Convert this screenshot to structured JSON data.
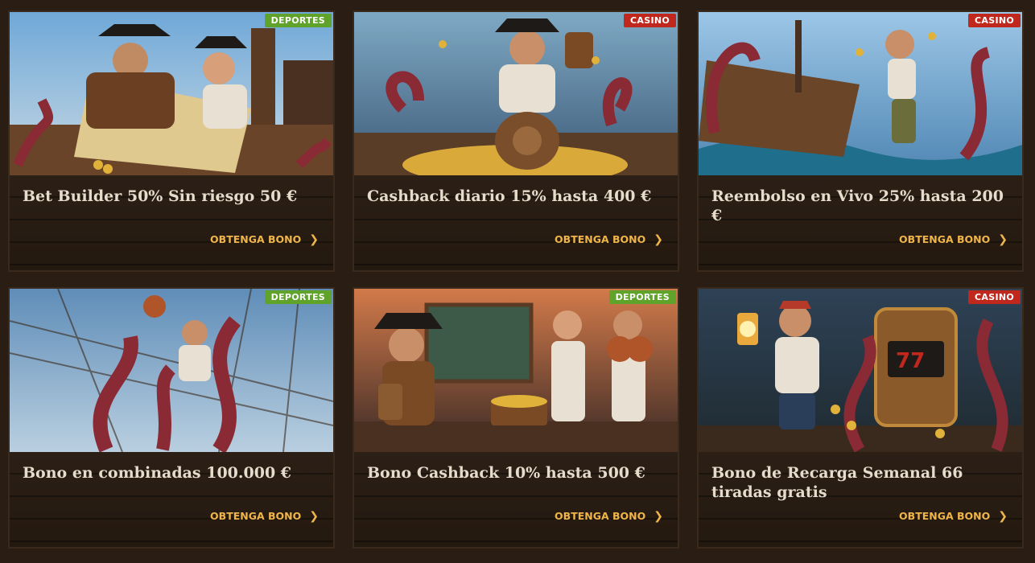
{
  "cards": [
    {
      "badge": "DEPORTES",
      "title": "Bet Builder 50% Sin riesgo 50 €",
      "cta": "OBTENGA BONO"
    },
    {
      "badge": "CASINO",
      "title": "Cashback diario 15% hasta 400 €",
      "cta": "OBTENGA BONO"
    },
    {
      "badge": "CASINO",
      "title": "Reembolso en Vivo 25% hasta 200 €",
      "cta": "OBTENGA BONO"
    },
    {
      "badge": "DEPORTES",
      "title": "Bono en combinadas 100.000 €",
      "cta": "OBTENGA BONO"
    },
    {
      "badge": "DEPORTES",
      "title": "Bono Cashback 10% hasta 500 €",
      "cta": "OBTENGA BONO"
    },
    {
      "badge": "CASINO",
      "title": "Bono de Recarga Semanal 66 tiradas gratis",
      "cta": "OBTENGA BONO"
    }
  ],
  "colors": {
    "sport_badge": "#5fa32a",
    "casino_badge": "#c0281e",
    "cta": "#f0b54a",
    "title": "#e6dccb"
  },
  "icons": {
    "cta": "chevron-right-icon"
  }
}
